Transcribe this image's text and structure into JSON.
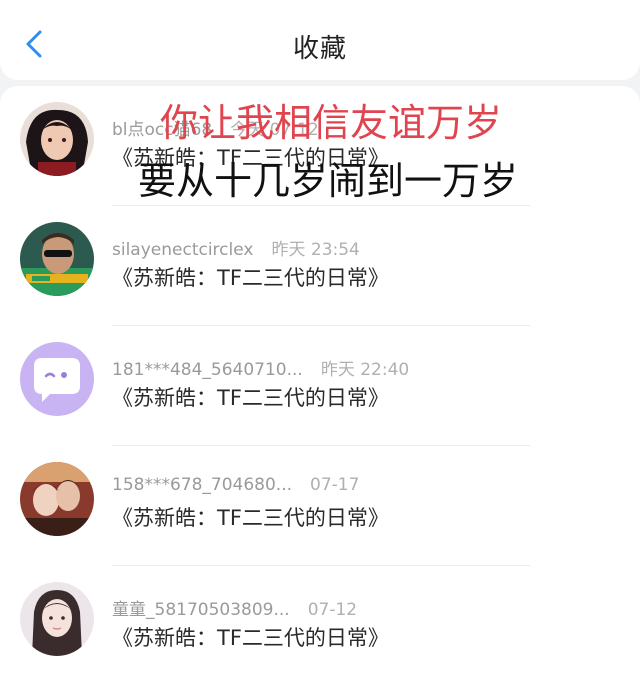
{
  "header": {
    "title": "收藏"
  },
  "items": [
    {
      "user": "bl点occ猫68",
      "time": "今天 07:12",
      "text": "《苏新皓：TF二三代的日常》",
      "avatar": "dark-haired-anime-avatar"
    },
    {
      "user": "silayenectcirclex",
      "time": "昨天 23:54",
      "text": "《苏新皓：TF二三代的日常》",
      "avatar": "sunglasses-photo-avatar"
    },
    {
      "user": "181***484_5640710...",
      "time": "昨天 22:40",
      "text": "《苏新皓：TF二三代的日常》",
      "avatar": "default-chat-bubble-avatar"
    },
    {
      "user": "158***678_704680...",
      "time": "07-17",
      "text": "《苏新皓：TF二三代的日常》",
      "avatar": "couple-photo-avatar"
    },
    {
      "user": "童童_58170503809...",
      "time": "07-12",
      "text": "《苏新皓：TF二三代的日常》",
      "avatar": "girl-photo-avatar"
    }
  ],
  "overlay": {
    "line1": "你让我相信友谊万岁",
    "line2": "要从十几岁闹到一万岁"
  },
  "colors": {
    "accent": "#2f8ff0",
    "overlay_red": "#e0454f"
  }
}
